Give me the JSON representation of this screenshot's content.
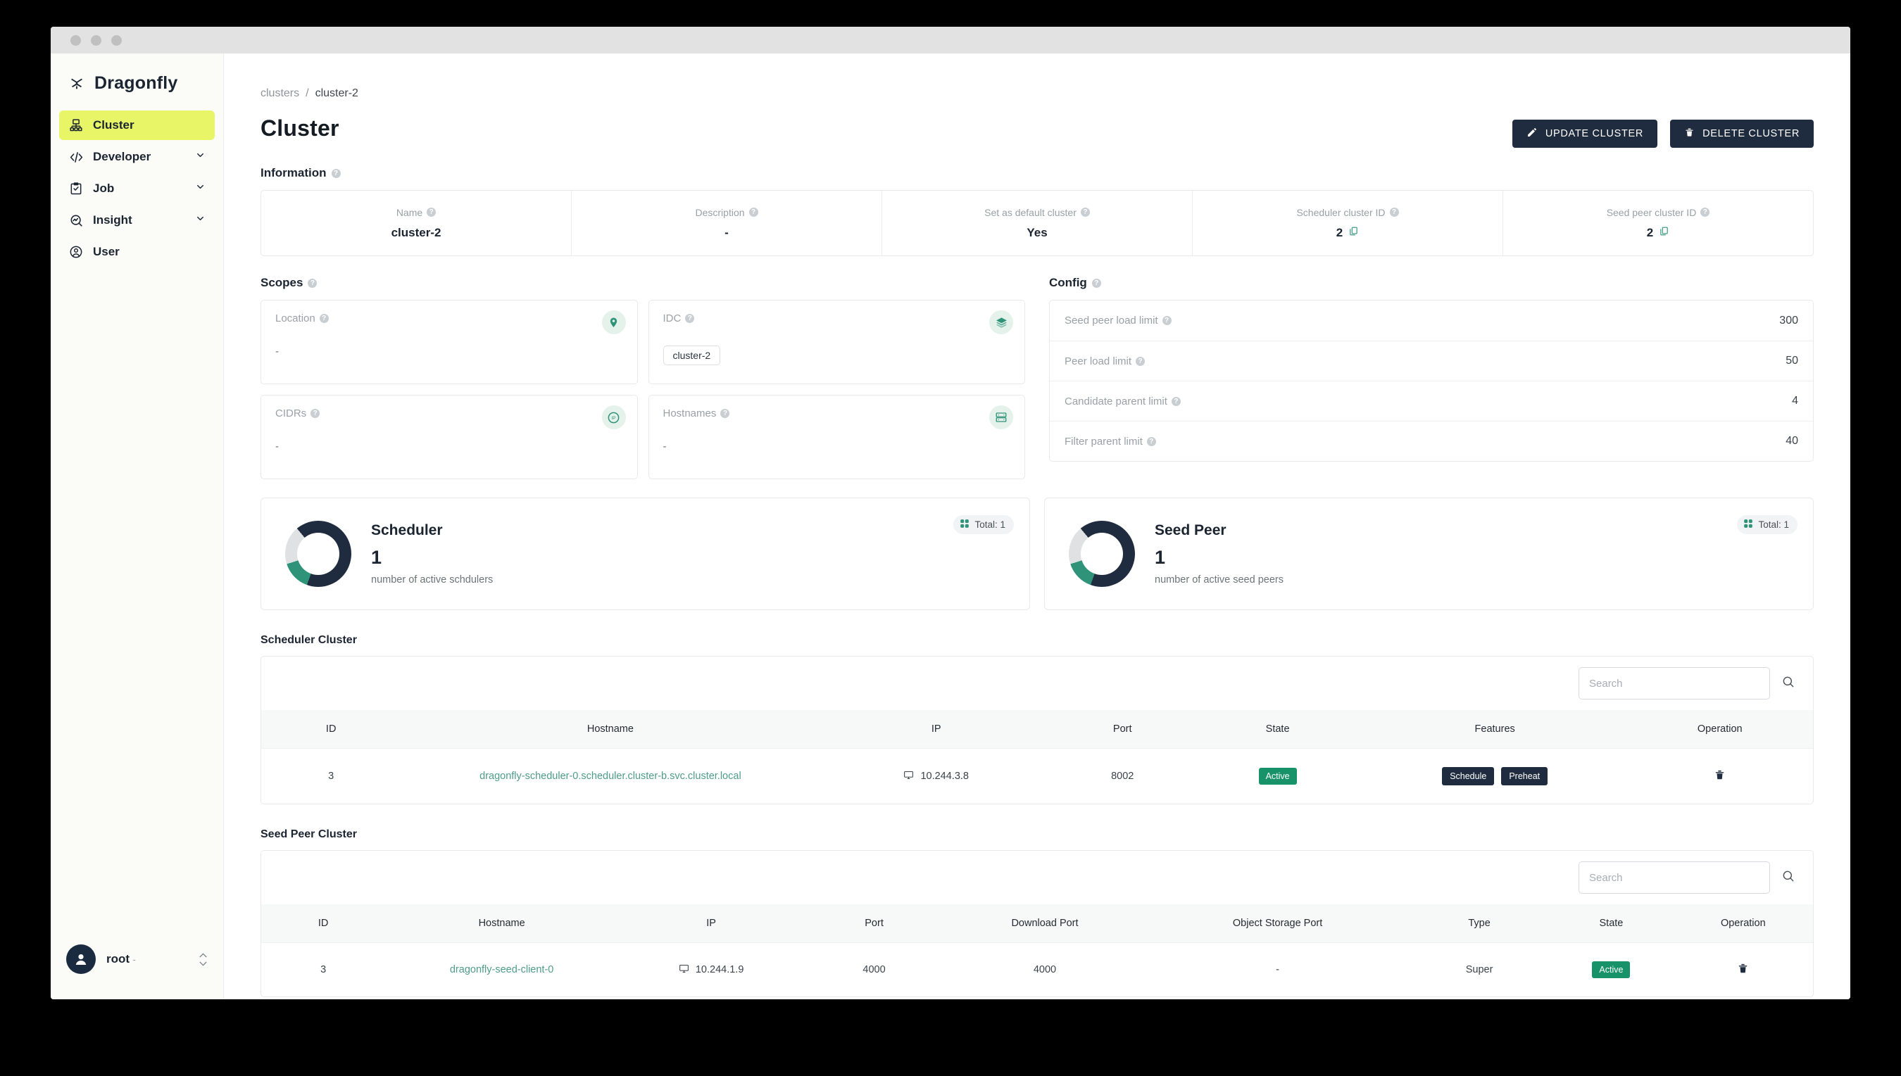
{
  "breadcrumb": {
    "root": "clusters",
    "sep": "/",
    "current": "cluster-2"
  },
  "page": {
    "title": "Cluster"
  },
  "sidebar": {
    "brand": "Dragonfly",
    "items": [
      {
        "label": "Cluster",
        "icon": "cluster-icon",
        "active": true,
        "expandable": false
      },
      {
        "label": "Developer",
        "icon": "code-icon",
        "active": false,
        "expandable": true
      },
      {
        "label": "Job",
        "icon": "clipboard-check-icon",
        "active": false,
        "expandable": true
      },
      {
        "label": "Insight",
        "icon": "insight-icon",
        "active": false,
        "expandable": true
      },
      {
        "label": "User",
        "icon": "user-circle-icon",
        "active": false,
        "expandable": false
      }
    ],
    "profile": {
      "name": "root",
      "email": "-"
    }
  },
  "header": {
    "update_label": "UPDATE CLUSTER",
    "delete_label": "DELETE CLUSTER"
  },
  "information": {
    "title": "Information",
    "cells": [
      {
        "label": "Name",
        "value": "cluster-2",
        "copy": false
      },
      {
        "label": "Description",
        "value": "-",
        "copy": false
      },
      {
        "label": "Set as default cluster",
        "value": "Yes",
        "copy": false
      },
      {
        "label": "Scheduler cluster ID",
        "value": "2",
        "copy": true
      },
      {
        "label": "Seed peer cluster ID",
        "value": "2",
        "copy": true
      }
    ]
  },
  "scopes": {
    "title": "Scopes",
    "cards": [
      {
        "label": "Location",
        "icon": "location-pin-icon",
        "value": "-",
        "chips": []
      },
      {
        "label": "IDC",
        "icon": "layers-icon",
        "value": "",
        "chips": [
          "cluster-2"
        ]
      },
      {
        "label": "CIDRs",
        "icon": "ip-icon",
        "value": "-",
        "chips": []
      },
      {
        "label": "Hostnames",
        "icon": "server-rack-icon",
        "value": "-",
        "chips": []
      }
    ]
  },
  "config": {
    "title": "Config",
    "rows": [
      {
        "label": "Seed peer load limit",
        "value": "300"
      },
      {
        "label": "Peer load limit",
        "value": "50"
      },
      {
        "label": "Candidate parent limit",
        "value": "4"
      },
      {
        "label": "Filter parent limit",
        "value": "40"
      }
    ]
  },
  "stats": [
    {
      "name": "Scheduler",
      "count": "1",
      "subtitle": "number of active schdulers",
      "total_label": "Total: 1",
      "accent": "#2f9379",
      "dark": "#1f2b3e",
      "light": "#e0e1e2"
    },
    {
      "name": "Seed Peer",
      "count": "1",
      "subtitle": "number of active seed peers",
      "total_label": "Total: 1",
      "accent": "#2f9379",
      "dark": "#1f2b3e",
      "light": "#e0e1e2"
    }
  ],
  "scheduler_table": {
    "title": "Scheduler Cluster",
    "search_placeholder": "Search",
    "search_value": "",
    "columns": [
      "ID",
      "Hostname",
      "IP",
      "Port",
      "State",
      "Features",
      "Operation"
    ],
    "rows": [
      {
        "id": "3",
        "hostname": "dragonfly-scheduler-0.scheduler.cluster-b.svc.cluster.local",
        "ip": "10.244.3.8",
        "port": "8002",
        "state": "Active",
        "features": [
          "Schedule",
          "Preheat"
        ]
      }
    ]
  },
  "seed_peer_table": {
    "title": "Seed Peer Cluster",
    "search_placeholder": "Search",
    "search_value": "",
    "columns": [
      "ID",
      "Hostname",
      "IP",
      "Port",
      "Download Port",
      "Object Storage Port",
      "Type",
      "State",
      "Operation"
    ],
    "rows": [
      {
        "id": "3",
        "hostname": "dragonfly-seed-client-0",
        "ip": "10.244.1.9",
        "port": "4000",
        "download_port": "4000",
        "object_storage_port": "-",
        "type": "Super",
        "state": "Active"
      }
    ]
  },
  "colors": {
    "accent_green": "#179269",
    "navy": "#1f2b3e",
    "lime": "#e8f566",
    "teal": "#4e9d86"
  }
}
